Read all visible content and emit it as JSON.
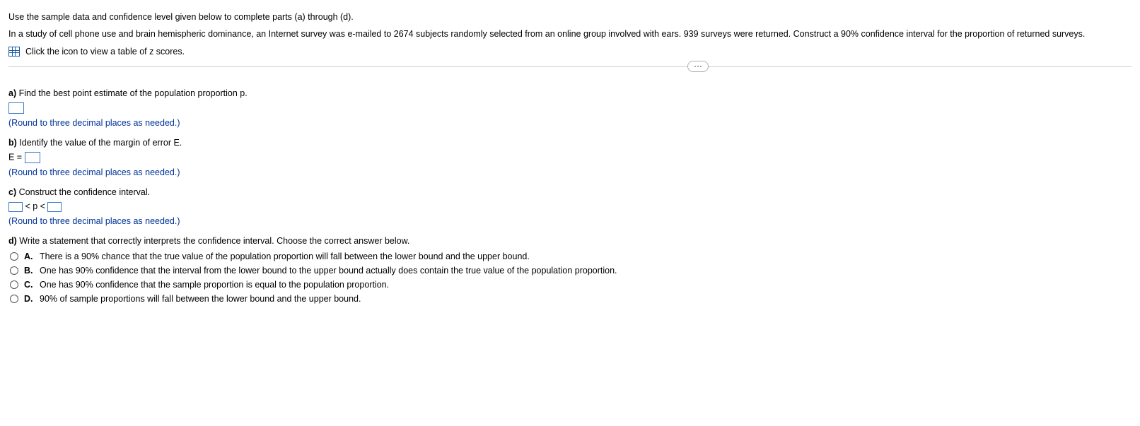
{
  "intro": {
    "line1": "Use the sample data and confidence level given below to complete parts (a) through (d).",
    "line2": "In a study of cell phone use and brain hemispheric dominance, an Internet survey was e-mailed to 2674 subjects randomly selected from an online group involved with ears. 939 surveys were returned. Construct a 90% confidence interval for the proportion of returned surveys.",
    "icon_link": "Click the icon to view a table of z scores."
  },
  "a": {
    "label": "a)",
    "prompt": " Find the best point estimate of the population proportion p.",
    "note": "(Round to three decimal places as needed.)"
  },
  "b": {
    "label": "b)",
    "prompt": " Identify the value of the margin of error E.",
    "prefix": "E = ",
    "note": "(Round to three decimal places as needed.)"
  },
  "c": {
    "label": "c)",
    "prompt": " Construct the confidence interval.",
    "mid": " < p < ",
    "note": "(Round to three decimal places as needed.)"
  },
  "d": {
    "label": "d)",
    "prompt": " Write a statement that correctly interprets the confidence interval. Choose the correct answer below.",
    "options": [
      {
        "letter": "A.",
        "text": "There is a 90% chance that the true value of the population proportion will fall between the lower bound and the upper bound."
      },
      {
        "letter": "B.",
        "text": "One has 90% confidence that the interval from the lower bound to the upper bound actually does contain the true value of the population proportion."
      },
      {
        "letter": "C.",
        "text": "One has 90% confidence that the sample proportion is equal to the population proportion."
      },
      {
        "letter": "D.",
        "text": "90% of sample proportions will fall between the lower bound and the upper bound."
      }
    ]
  }
}
